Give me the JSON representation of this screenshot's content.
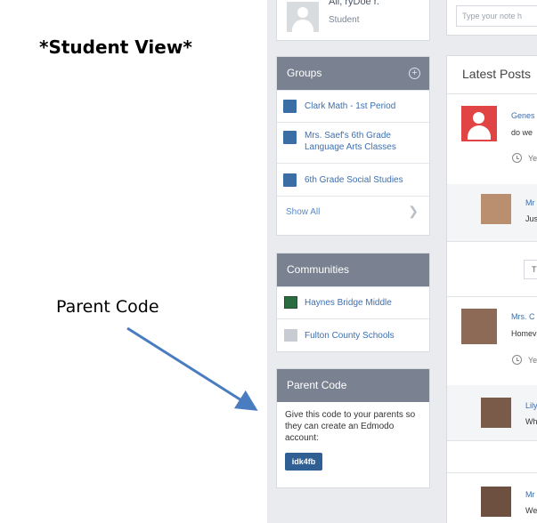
{
  "annotation": {
    "title": "*Student View*",
    "arrow_label": "Parent Code"
  },
  "profile": {
    "name": "Ali, ryDoe r.",
    "role": "Student"
  },
  "groups": {
    "title": "Groups",
    "items": [
      {
        "label": "Clark Math - 1st Period"
      },
      {
        "label": "Mrs. Saef's 6th Grade Language Arts Classes"
      },
      {
        "label": "6th Grade Social Studies"
      }
    ],
    "show_all": "Show All"
  },
  "communities": {
    "title": "Communities",
    "items": [
      {
        "label": "Haynes Bridge Middle"
      },
      {
        "label": "Fulton County Schools"
      }
    ]
  },
  "parent_code": {
    "title": "Parent Code",
    "description": "Give this code to your parents so they can create an Edmodo account:",
    "code": "idk4fb"
  },
  "note_input": {
    "placeholder": "Type your note h"
  },
  "feed": {
    "title": "Latest Posts",
    "posts": [
      {
        "name": "Genes",
        "text": "do we",
        "time": "Ye"
      },
      {
        "name": "Mr",
        "text": "Jus"
      },
      {
        "more": "T"
      },
      {
        "name": "Mrs. C",
        "text": "Homev",
        "time": "Ye"
      },
      {
        "name": "Lily",
        "text": "Wh"
      },
      {
        "name": "Mr",
        "text": "We"
      }
    ]
  },
  "colors": {
    "panel_header": "#7a8291",
    "link": "#3c6fb0",
    "group_square": "#3a6ea5",
    "code_badge": "#2f5f93",
    "arrow": "#4a7cc0",
    "avatar_red": "#e04444"
  }
}
